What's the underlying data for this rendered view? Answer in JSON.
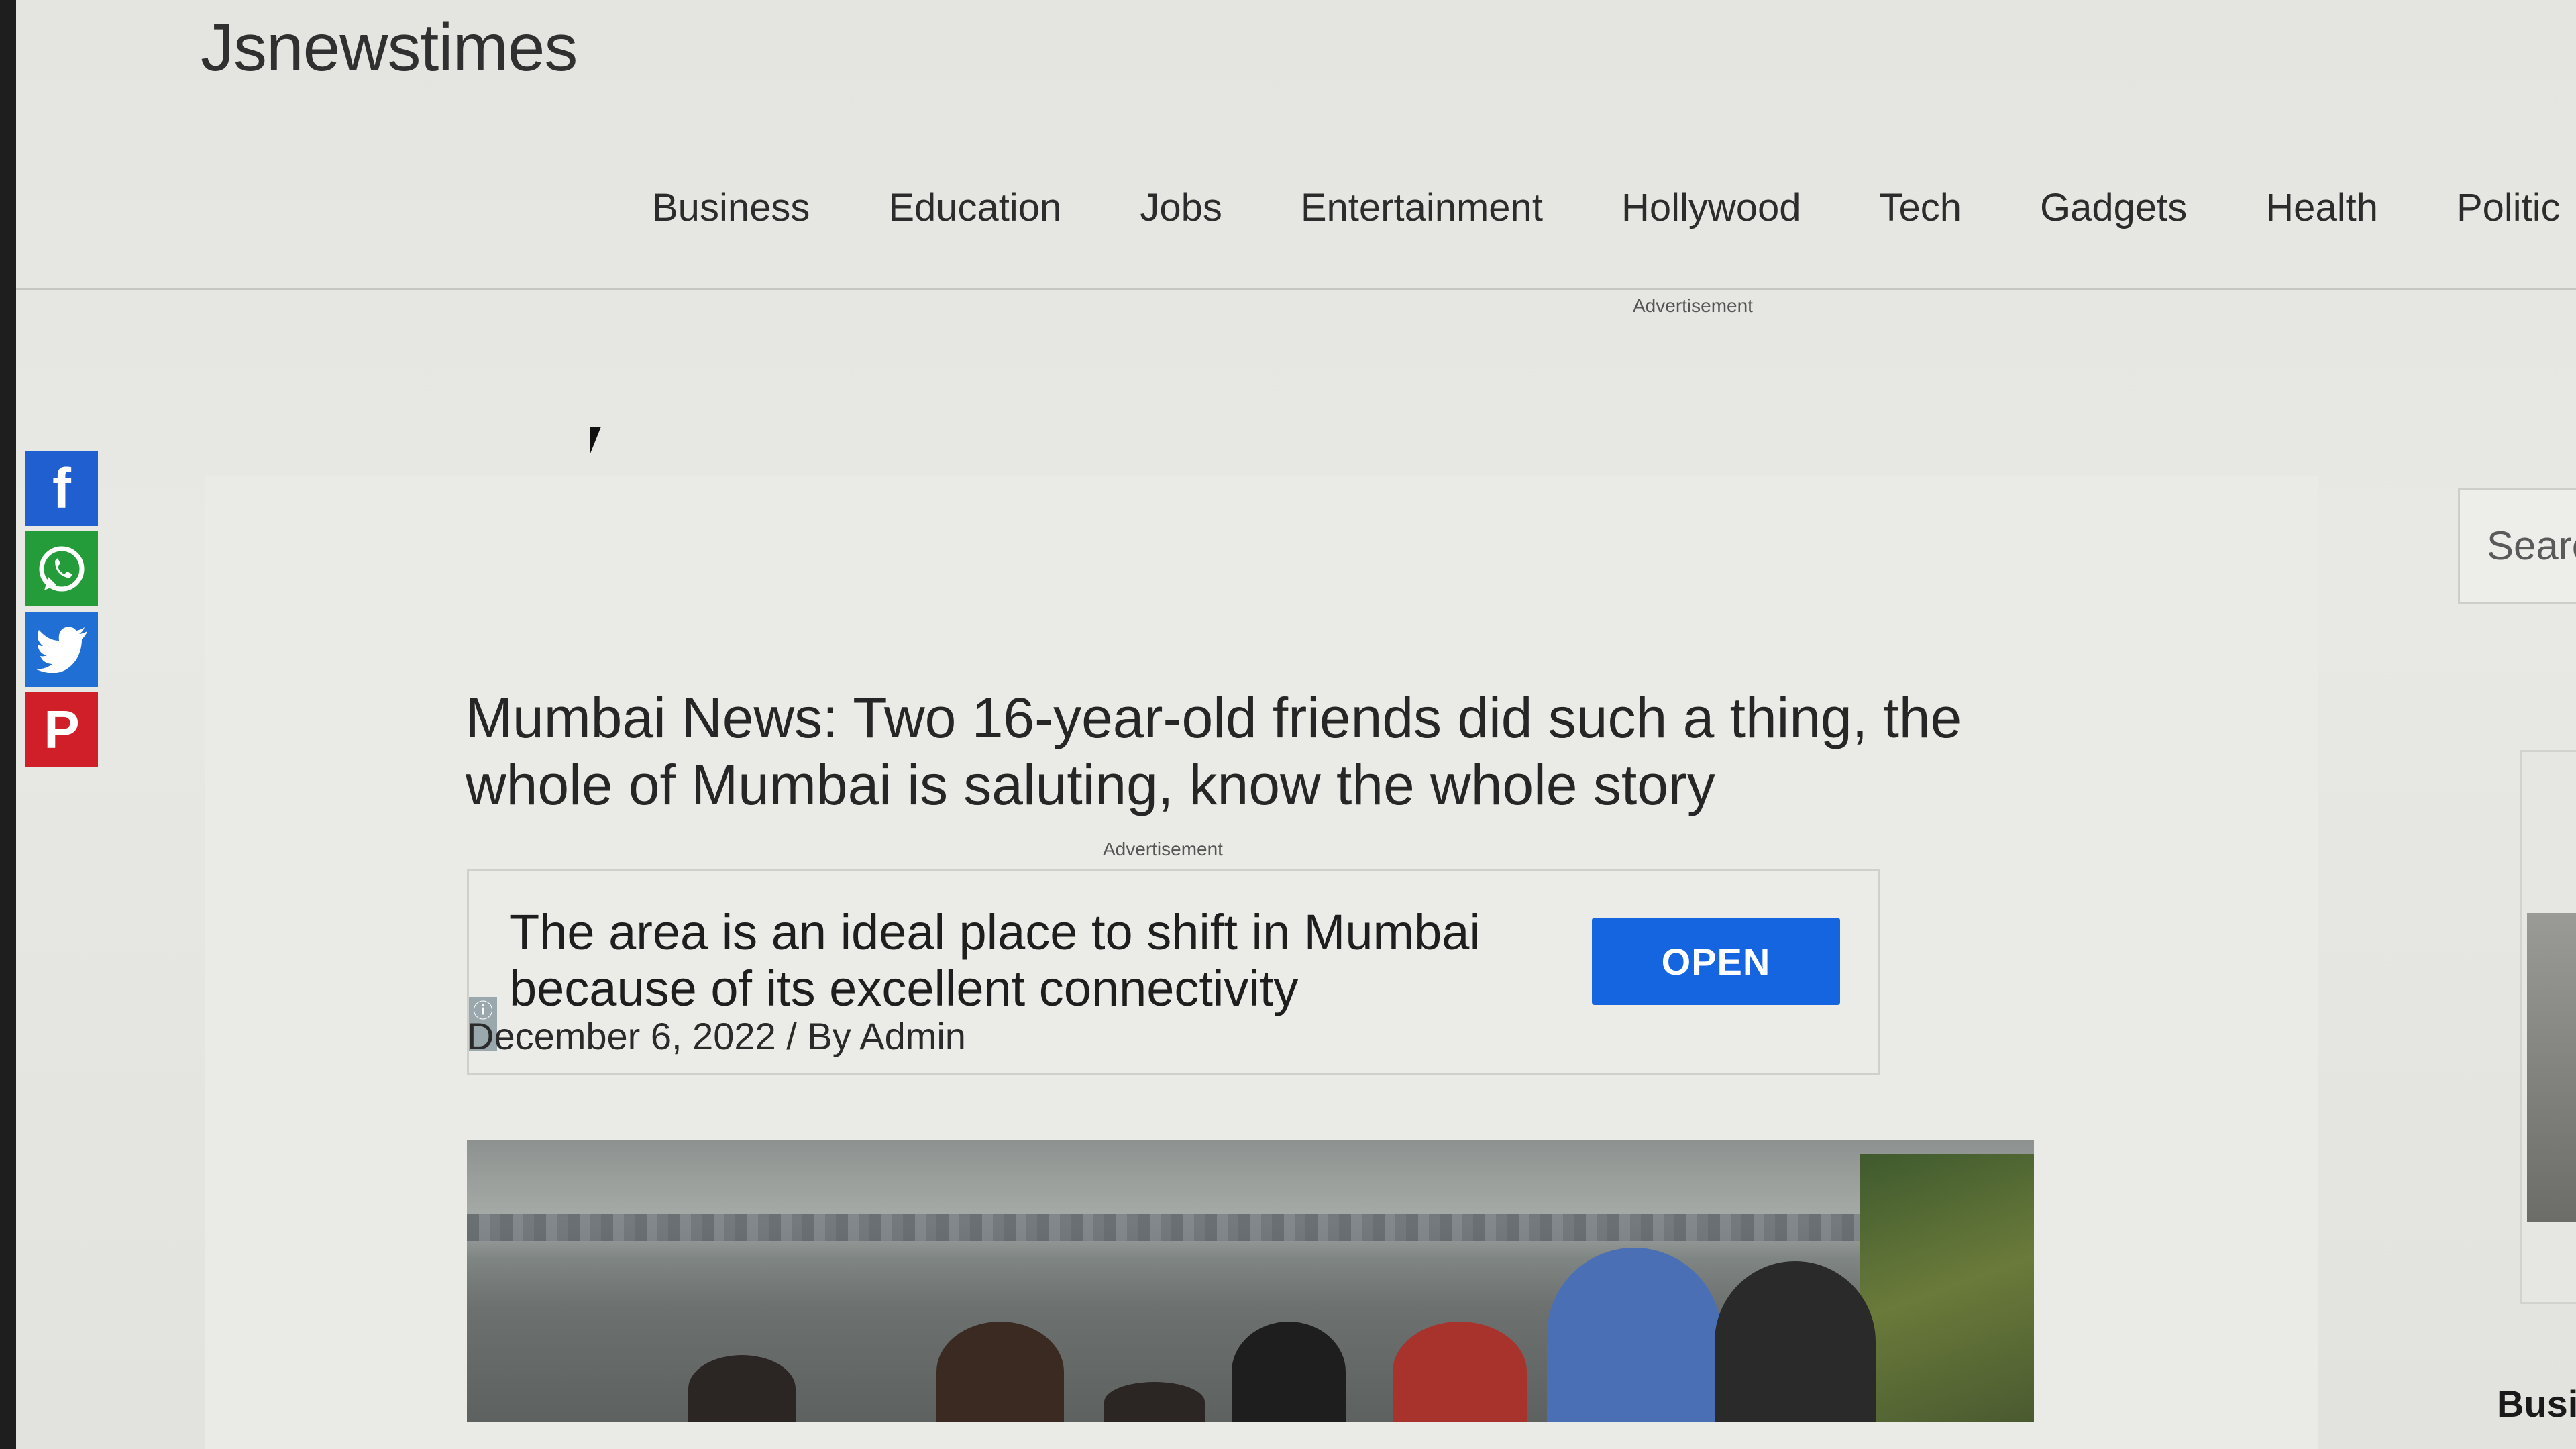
{
  "site": {
    "title": "Jsnewstimes"
  },
  "nav": {
    "items": [
      "Business",
      "Education",
      "Jobs",
      "Entertainment",
      "Hollywood",
      "Tech",
      "Gadgets",
      "Health",
      "Politic"
    ]
  },
  "ads": {
    "top_label": "Advertisement",
    "mid_label": "Advertisement",
    "text": "The area is an ideal place to shift in Mumbai because of its excellent connectivity",
    "button": "OPEN"
  },
  "share": {
    "icons": [
      "facebook-icon",
      "whatsapp-icon",
      "twitter-icon",
      "pinterest-icon"
    ],
    "colors": {
      "facebook": "#1f5fd0",
      "whatsapp": "#249c3a",
      "twitter": "#1f6fd4",
      "pinterest": "#d11f2a"
    }
  },
  "article": {
    "headline": "Mumbai News: Two 16-year-old friends did such a thing, the whole of Mumbai is saluting, know the whole story",
    "meta": "December 6, 2022 / By Admin"
  },
  "sidebar": {
    "search_placeholder": "Searc",
    "heading": "Busir"
  }
}
